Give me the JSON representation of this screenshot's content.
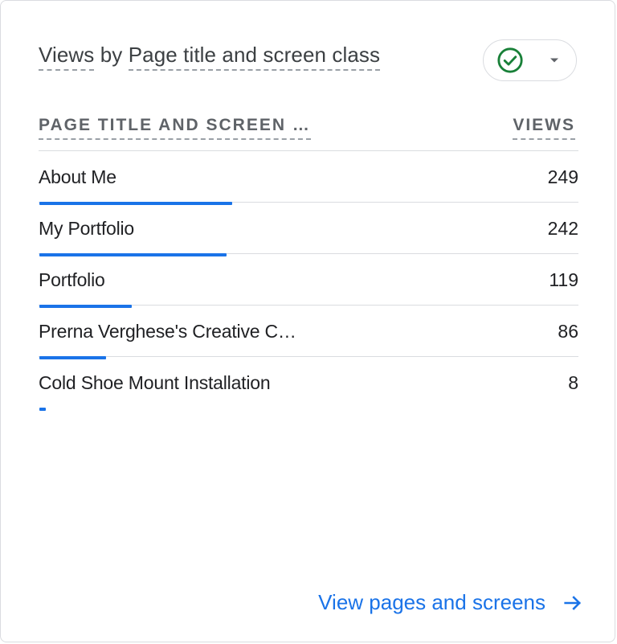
{
  "card": {
    "title_prefix": "Views",
    "title_by": " by ",
    "title_dimension": "Page title and screen class",
    "status_icon": "check-circle-icon",
    "dropdown_icon": "caret-down-icon",
    "colors": {
      "accent": "#1a73e8",
      "check": "#188038",
      "divider": "#dadce0"
    }
  },
  "table": {
    "col_dimension": "PAGE TITLE AND SCREEN …",
    "col_metric": "VIEWS",
    "rows": [
      {
        "label": "About Me",
        "value": "249",
        "fraction": 1.0
      },
      {
        "label": "My Portfolio",
        "value": "242",
        "fraction": 0.972
      },
      {
        "label": "Portfolio",
        "value": "119",
        "fraction": 0.478
      },
      {
        "label": "Prerna Verghese's Creative C…",
        "value": "86",
        "fraction": 0.345
      },
      {
        "label": "Cold Shoe Mount Installation",
        "value": "8",
        "fraction": 0.032
      }
    ]
  },
  "footer": {
    "link_label": "View pages and screens",
    "link_icon": "arrow-forward-icon"
  }
}
